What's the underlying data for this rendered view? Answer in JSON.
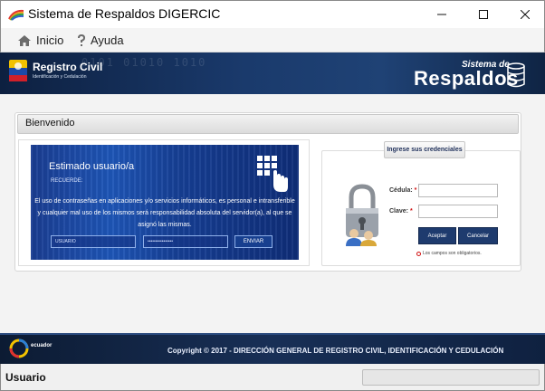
{
  "window": {
    "title": "Sistema de Respaldos DIGERCIC",
    "minimize_icon": "minimize-icon",
    "maximize_icon": "maximize-icon",
    "close_icon": "close-icon"
  },
  "menu": {
    "items": [
      {
        "label": "Inicio",
        "icon": "home-icon"
      },
      {
        "label": "Ayuda",
        "icon": "question-icon"
      }
    ]
  },
  "banner": {
    "org_name": "Registro Civil",
    "org_subtitle": "Identificación y Cedulación",
    "system_top": "Sistema de",
    "system_main": "Respaldos",
    "binary_text": "0101 01010 1010",
    "colors": {
      "background": "#1a3a6c"
    }
  },
  "panel": {
    "title": "Bienvenido"
  },
  "promo": {
    "greeting": "Estimado usuario/a",
    "recuerde": "RECUERDE:",
    "message": "El uso de contraseñas en aplicaciones y/o servicios informáticos, es personal e intransferible y cualquier mal uso de los mismos será responsabilidad absoluta del servidor(a), al que se asignó las mismas.",
    "user_field": "USUARIO",
    "password_field": "••••••••••••••••",
    "send_label": "ENVIAR"
  },
  "login": {
    "section_title": "Ingrese sus credenciales",
    "cedula_label": "Cédula:",
    "clave_label": "Clave:",
    "required_mark": "*",
    "cedula_value": "",
    "clave_value": "",
    "accept_label": "Aceptar",
    "cancel_label": "Cancelar",
    "required_note": "Los campos son obligatorios.",
    "colors": {
      "button": "#1e3b6e",
      "required": "#d01010"
    }
  },
  "footer": {
    "ecuador_label": "ecuador",
    "copyright": "Copyright © 2017 - DIRECCIÓN GENERAL DE REGISTRO CIVIL, IDENTIFICACIÓN Y CEDULACIÓN"
  },
  "status": {
    "label": "Usuario"
  }
}
